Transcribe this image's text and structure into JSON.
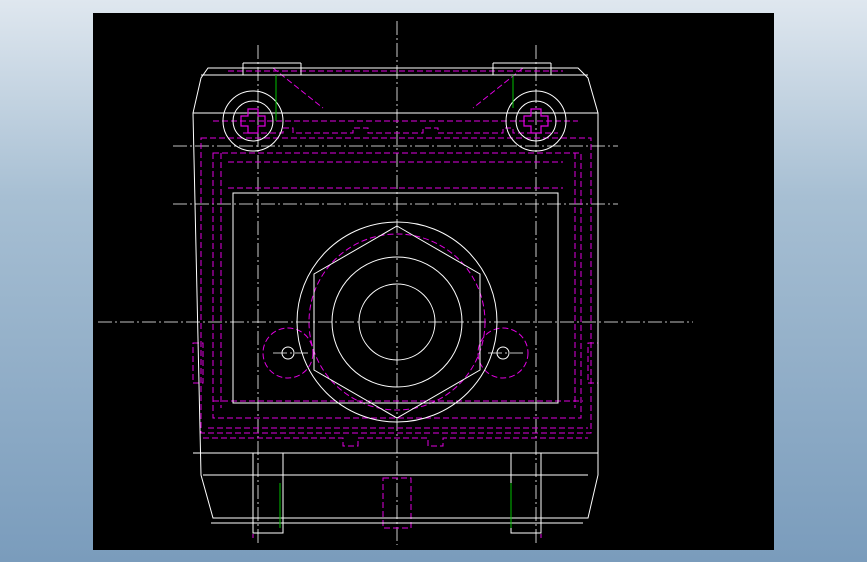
{
  "drawing": {
    "background": "#000000",
    "page_background": "#8fabc6",
    "colors": {
      "outline": "#ffffff",
      "hidden": "#e000e0",
      "center": "#ffffff",
      "accent": "#00c000"
    },
    "line_styles": {
      "outline": "solid",
      "hidden": "dashed",
      "center": "dash-dot"
    },
    "view": "front-view",
    "features": [
      "body-outline",
      "central-port",
      "hex-boss",
      "mounting-screw-left",
      "mounting-screw-right",
      "side-holes",
      "hidden-edges",
      "center-lines"
    ]
  }
}
